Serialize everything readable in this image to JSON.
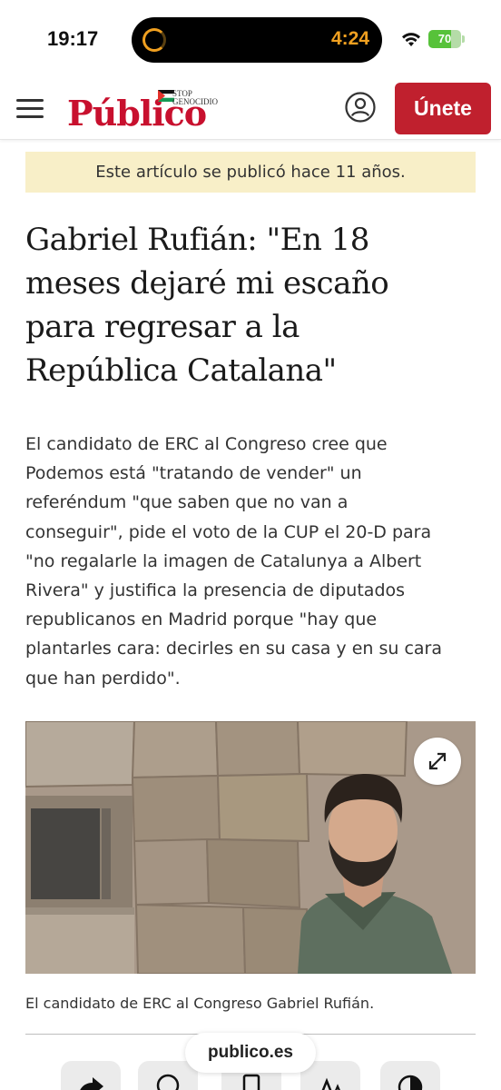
{
  "status_bar": {
    "time": "19:17",
    "activity_timer": "4:24",
    "battery_level": "70",
    "battery_fraction": 0.7
  },
  "header": {
    "logo_text": "Público",
    "logo_tagline_line1": "STOP",
    "logo_tagline_line2": "GENOCIDIO",
    "join_label": "Únete",
    "brand_color": "#c0202e"
  },
  "article": {
    "notice": "Este artículo se publicó hace 11 años.",
    "headline": "Gabriel Rufián: \"En 18 meses dejaré mi escaño para regresar a la República Catalana\"",
    "lead": "El candidato de ERC al Congreso cree que Podemos está \"tratando de vender\" un referéndum \"que saben que no van a conseguir\", pide el voto de la CUP el 20-D para \"no regalarle la imagen de Catalunya a Albert Rivera\" y justifica la presencia de diputados republicanos en Madrid porque \"hay que plantarles cara: decirles en su casa y en su cara que han perdido\".",
    "caption": "El candidato de ERC al Congreso Gabriel Rufián."
  },
  "browser": {
    "url": "publico.es",
    "tools": [
      "share-icon",
      "comment-icon",
      "bookmark-icon",
      "text-size-icon",
      "contrast-icon"
    ]
  }
}
